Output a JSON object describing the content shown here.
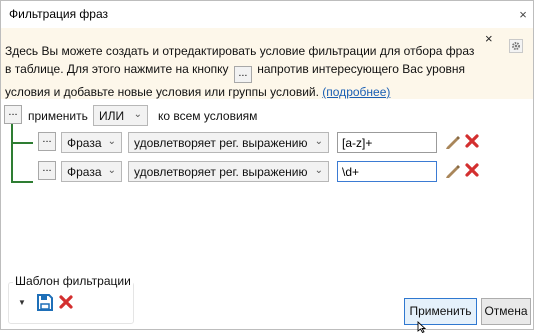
{
  "window": {
    "title": "Фильтрация фраз",
    "close_glyph": "×"
  },
  "info": {
    "text_before": "Здесь Вы можете создать и отредактировать условие фильтрации для отбора фраз в таблице. Для этого нажмите на кнопку",
    "inline_button": "...",
    "text_after": "напротив интересующего Вас уровня условия и добавьте новые условия или группы условий.",
    "link": "(подробнее)",
    "close_glyph": "×",
    "gear_icon": "gear-icon"
  },
  "root": {
    "dots": "...",
    "apply_label": "применить",
    "operator": "ИЛИ",
    "to_all_label": "ко всем условиям"
  },
  "conditions": [
    {
      "dots": "...",
      "field": "Фраза",
      "comparison": "удовлетворяет рег. выражению",
      "value": "[a-z]+"
    },
    {
      "dots": "...",
      "field": "Фраза",
      "comparison": "удовлетворяет рег. выражению",
      "value": "\\d+"
    }
  ],
  "template": {
    "title": "Шаблон фильтрации"
  },
  "buttons": {
    "apply": "Применить",
    "cancel": "Отмена"
  },
  "colors": {
    "tree": "#2e7d32",
    "delete": "#d32f2f",
    "save": "#1e6fb8",
    "info_bg": "#fdf7ea"
  }
}
